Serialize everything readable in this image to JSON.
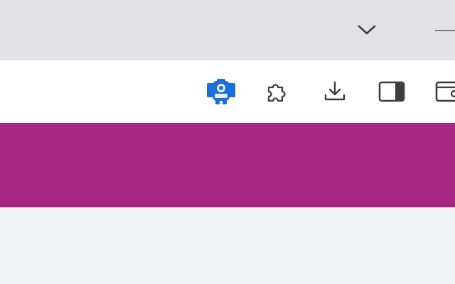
{
  "tabstrip": {
    "tab_search_icon": "chevron-down-icon",
    "minimize_icon": "minimize-icon"
  },
  "toolbar": {
    "buttons": [
      {
        "name": "extension-robot-button",
        "icon": "robot-extension-icon",
        "color": "#1a6fd8"
      },
      {
        "name": "extensions-button",
        "icon": "puzzle-icon"
      },
      {
        "name": "downloads-button",
        "icon": "download-icon"
      },
      {
        "name": "side-panel-button",
        "icon": "side-panel-icon"
      },
      {
        "name": "window-overflow-button",
        "icon": "window-icon"
      }
    ]
  },
  "colors": {
    "tabstrip_bg": "#e2e1e6",
    "toolbar_bg": "#ffffff",
    "banner": "#a72785",
    "page_bg": "#eff1f4",
    "icon": "#5f6368"
  }
}
